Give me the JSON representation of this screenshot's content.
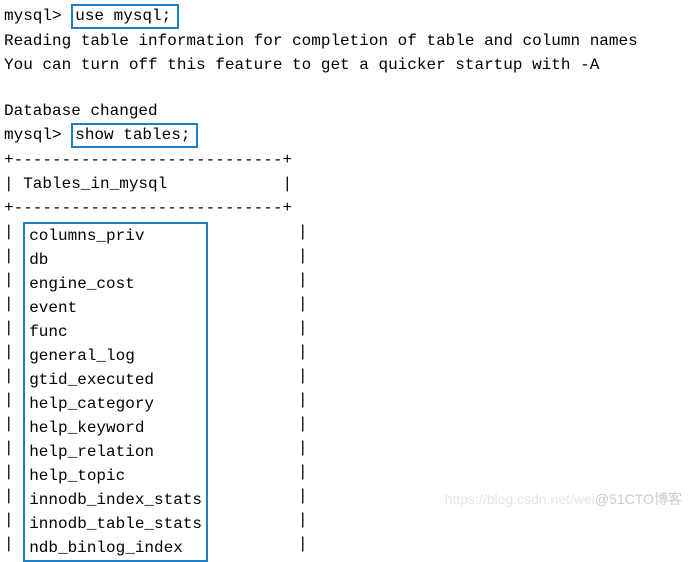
{
  "line1": {
    "prompt": "mysql>",
    "command": "use mysql;"
  },
  "line2": "Reading table information for completion of table and column names",
  "line3": "You can turn off this feature to get a quicker startup with -A",
  "line4": "Database changed",
  "line5": {
    "prompt": "mysql>",
    "command": "show tables;"
  },
  "table": {
    "border_top": "+----------------------------+",
    "header": "| Tables_in_mysql            |",
    "border_mid": "+----------------------------+",
    "rows": [
      "columns_priv",
      "db",
      "engine_cost",
      "event",
      "func",
      "general_log",
      "gtid_executed",
      "help_category",
      "help_keyword",
      "help_relation",
      "help_topic",
      "innodb_index_stats",
      "innodb_table_stats"
    ],
    "partial_row": "ndb_binlog_index",
    "pipe": "| ",
    "end_pipe": "|"
  },
  "watermark": {
    "light": "https://blog.csdn.net/wei",
    "dark": "@51CTO博客"
  }
}
